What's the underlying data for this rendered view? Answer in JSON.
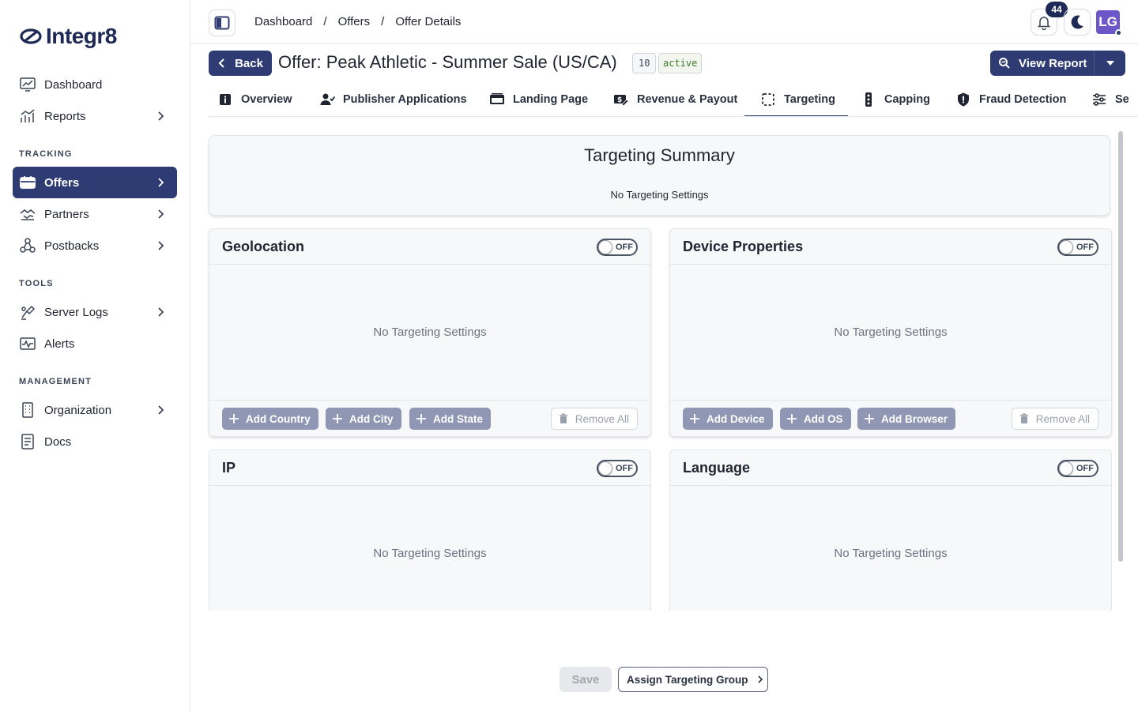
{
  "app": {
    "name": "Integr8"
  },
  "sidebar": {
    "top_items": [
      {
        "label": "Dashboard",
        "icon": "dashboard-icon",
        "has_chevron": false
      },
      {
        "label": "Reports",
        "icon": "reports-icon",
        "has_chevron": true
      }
    ],
    "sections": [
      {
        "label": "TRACKING",
        "items": [
          {
            "label": "Offers",
            "icon": "offers-icon",
            "active": true
          },
          {
            "label": "Partners",
            "icon": "partners-icon"
          },
          {
            "label": "Postbacks",
            "icon": "postbacks-icon"
          }
        ]
      },
      {
        "label": "TOOLS",
        "items": [
          {
            "label": "Server Logs",
            "icon": "server-logs-icon"
          },
          {
            "label": "Alerts",
            "icon": "alerts-icon"
          }
        ]
      },
      {
        "label": "MANAGEMENT",
        "items": [
          {
            "label": "Organization",
            "icon": "organization-icon"
          },
          {
            "label": "Docs",
            "icon": "docs-icon"
          }
        ]
      }
    ]
  },
  "header": {
    "breadcrumb": [
      "Dashboard",
      "Offers",
      "Offer Details"
    ],
    "breadcrumb_separator": "/",
    "notifications_count": "44",
    "avatar_initials": "LG"
  },
  "offer": {
    "back_label": "Back",
    "title": "Offer: Peak Athletic - Summer Sale (US/CA)",
    "id": "10",
    "status": "active",
    "view_report_label": "View Report"
  },
  "tabs": [
    {
      "label": "Overview",
      "icon": "info-icon"
    },
    {
      "label": "Publisher Applications",
      "icon": "user-check-icon"
    },
    {
      "label": "Landing Page",
      "icon": "browser-icon"
    },
    {
      "label": "Revenue & Payout",
      "icon": "money-icon"
    },
    {
      "label": "Targeting",
      "icon": "target-frame-icon",
      "active": true
    },
    {
      "label": "Capping",
      "icon": "traffic-light-icon"
    },
    {
      "label": "Fraud Detection",
      "icon": "shield-icon"
    },
    {
      "label": "Se",
      "icon": "sliders-icon"
    }
  ],
  "summary": {
    "title": "Targeting Summary",
    "text": "No Targeting Settings"
  },
  "panels": {
    "geolocation": {
      "title": "Geolocation",
      "toggle_label": "OFF",
      "empty_text": "No Targeting Settings",
      "add_buttons": [
        "Add Country",
        "Add City",
        "Add State"
      ],
      "remove_label": "Remove All"
    },
    "device": {
      "title": "Device Properties",
      "toggle_label": "OFF",
      "empty_text": "No Targeting Settings",
      "add_buttons": [
        "Add Device",
        "Add OS",
        "Add Browser"
      ],
      "remove_label": "Remove All"
    },
    "ip": {
      "title": "IP",
      "toggle_label": "OFF",
      "empty_text": "No Targeting Settings"
    },
    "language": {
      "title": "Language",
      "toggle_label": "OFF",
      "empty_text": "No Targeting Settings"
    }
  },
  "actions": {
    "save_label": "Save",
    "assign_label": "Assign Targeting Group"
  },
  "colors": {
    "brand_navy": "#2f3b73",
    "add_button": "#9097b5",
    "status_green": "#3c7a2a",
    "avatar": "#6b57c7"
  }
}
